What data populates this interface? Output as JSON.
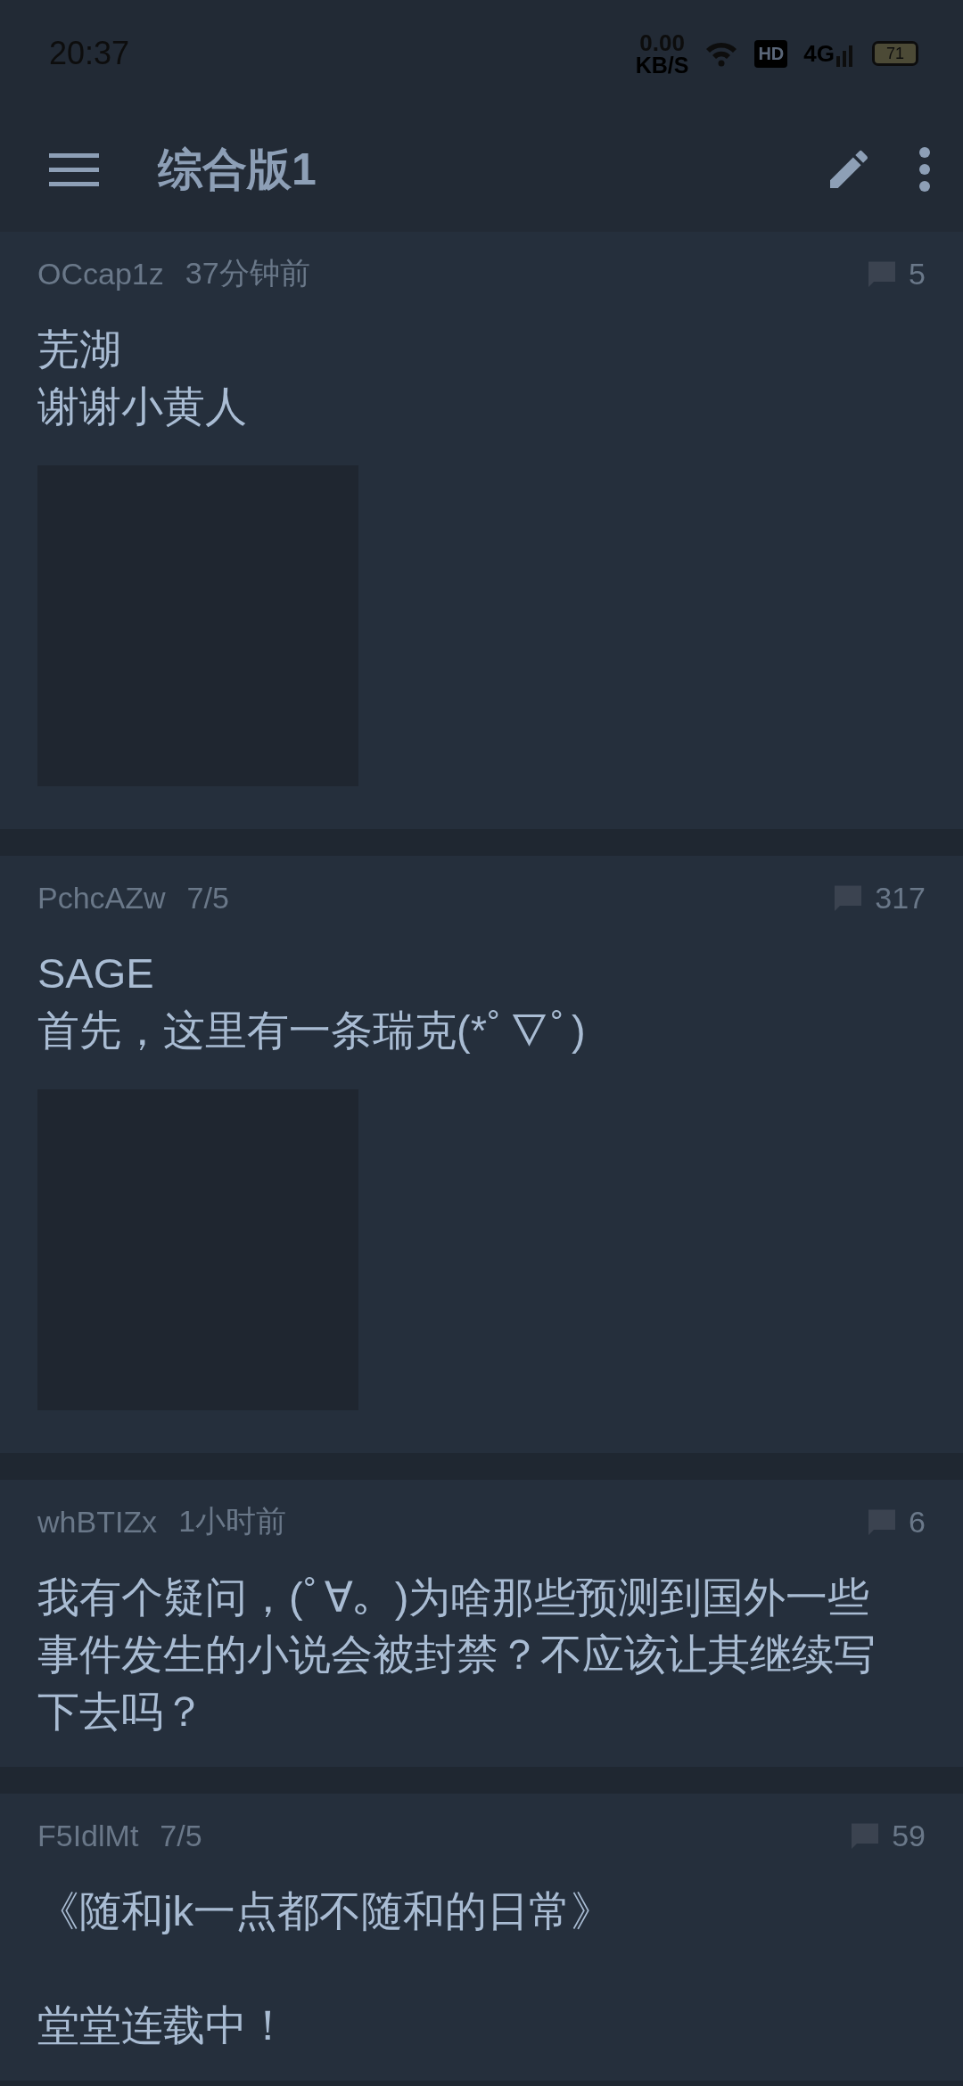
{
  "status_bar": {
    "time": "20:37",
    "net_speed": "0.00",
    "net_unit": "KB/S",
    "hd": "HD",
    "network": "4G",
    "battery": "71"
  },
  "toolbar": {
    "title": "综合版1"
  },
  "posts": [
    {
      "user": "OCcap1z",
      "time": "37分钟前",
      "replies": "5",
      "paragraphs": [
        [
          "芜湖",
          "谢谢小黄人"
        ]
      ],
      "image": true
    },
    {
      "user": "PchcAZw",
      "time": "7/5",
      "replies": "317",
      "paragraphs": [
        [
          "SAGE",
          "首先，这里有一条瑞克(*ﾟ∇ﾟ)"
        ]
      ],
      "image": true
    },
    {
      "user": "whBTIZx",
      "time": "1小时前",
      "replies": "6",
      "paragraphs": [
        [
          "我有个疑问，(ﾟ∀。)为啥那些预测到国外一些事件发生的小说会被封禁？不应该让其继续写下去吗？"
        ]
      ],
      "image": false
    },
    {
      "user": "F5IdlMt",
      "time": "7/5",
      "replies": "59",
      "paragraphs": [
        [
          "《随和jk一点都不随和的日常》"
        ],
        [
          "堂堂连载中！"
        ]
      ],
      "image": false
    }
  ]
}
